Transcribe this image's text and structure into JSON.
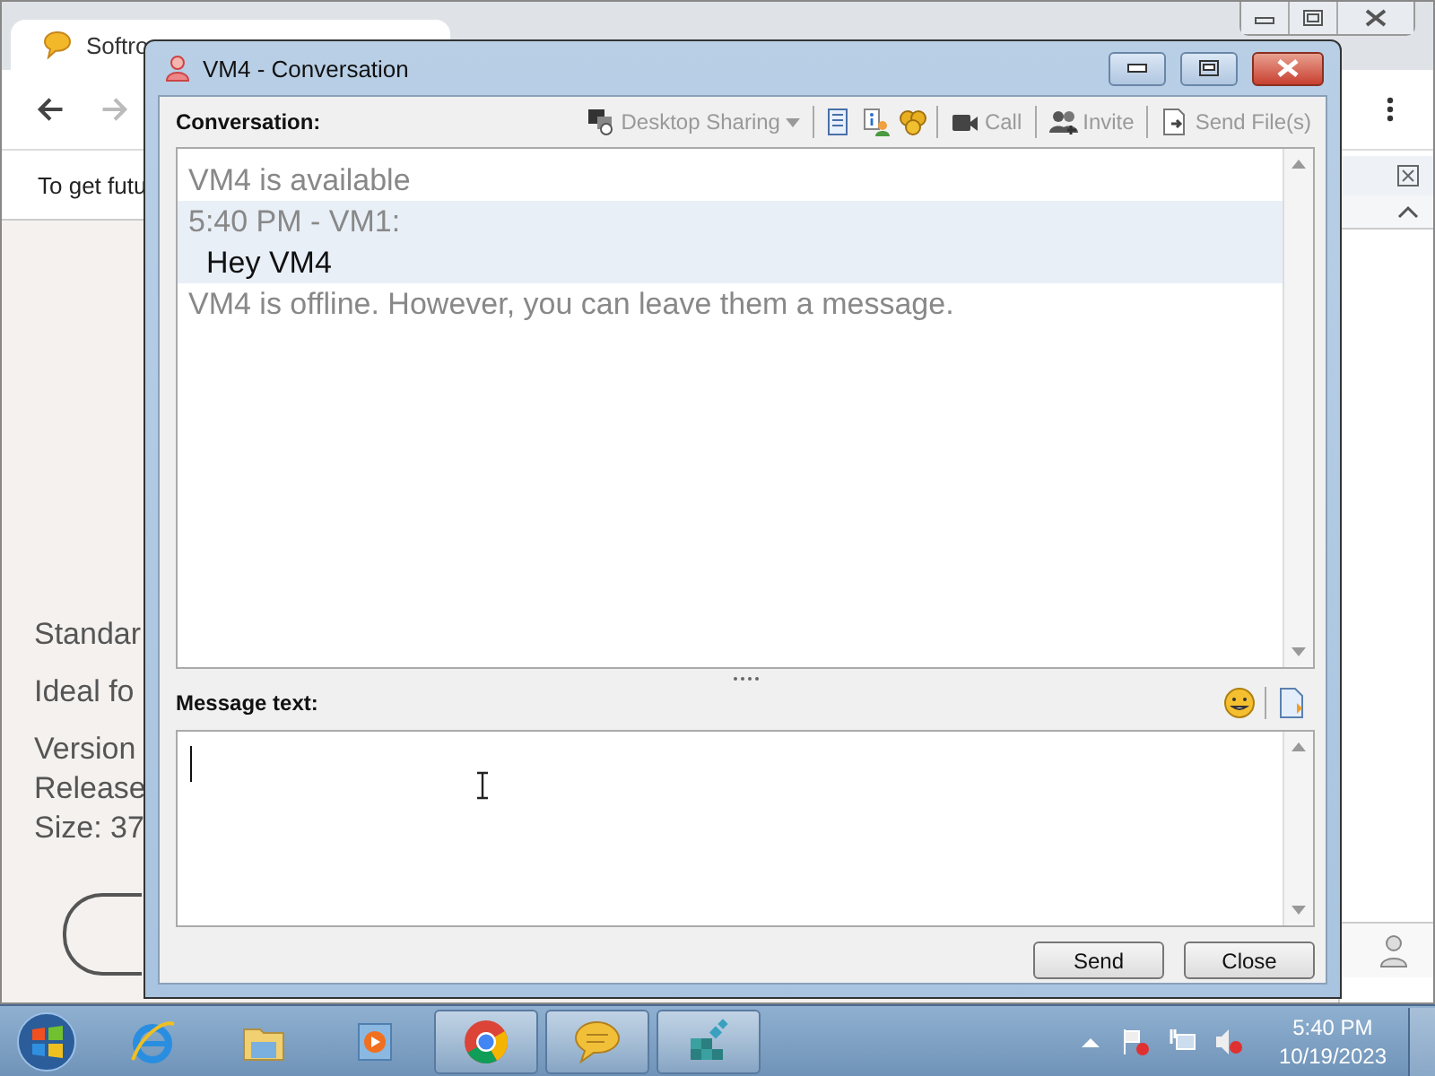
{
  "browser": {
    "tab_title": "Softro",
    "notice": "To get futu",
    "details": [
      "Standar",
      "Ideal fo",
      "Version",
      "Release",
      "Size: 37"
    ]
  },
  "conversation_window": {
    "title": "VM4 - Conversation",
    "conversation_label": "Conversation:",
    "toolbar": [
      {
        "label": "Desktop Sharing",
        "disabled": true
      },
      {
        "label": "Call",
        "disabled": true
      },
      {
        "label": "Invite",
        "disabled": true
      },
      {
        "label": "Send File(s)",
        "disabled": true
      }
    ],
    "messages": [
      {
        "kind": "status",
        "text": "VM4 is available"
      },
      {
        "kind": "header",
        "text": "5:40 PM - VM1:"
      },
      {
        "kind": "message",
        "text": "Hey VM4"
      },
      {
        "kind": "status",
        "text": "VM4 is offline. However, you can leave them a message."
      }
    ],
    "message_label": "Message text:",
    "buttons": [
      "Send",
      "Close"
    ]
  },
  "taskbar": {
    "apps": [
      {
        "open": false
      },
      {
        "open": false
      },
      {
        "open": false
      },
      {
        "open": true
      },
      {
        "open": true
      },
      {
        "open": true
      }
    ],
    "time": "5:40 PM",
    "date": "10/19/2023"
  }
}
